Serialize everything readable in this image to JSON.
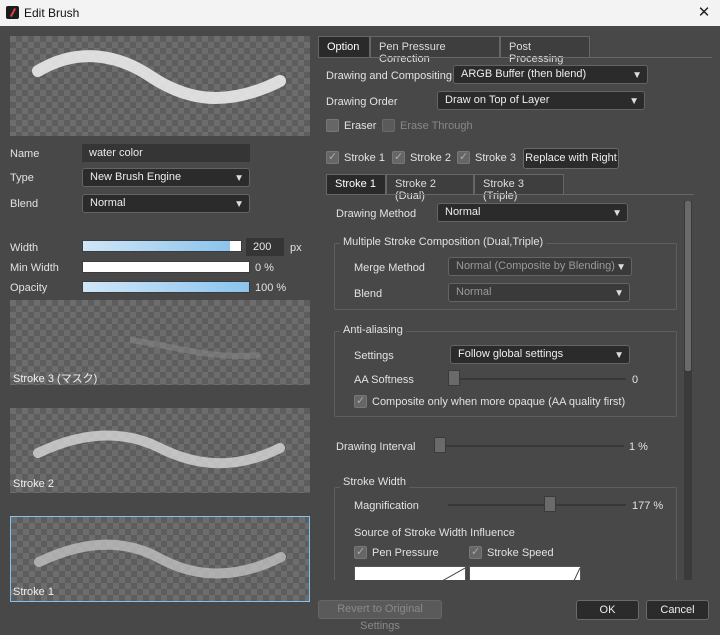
{
  "window": {
    "title": "Edit Brush",
    "close": "✕"
  },
  "left": {
    "name_label": "Name",
    "name_value": "water color",
    "type_label": "Type",
    "type_value": "New Brush Engine",
    "blend_label": "Blend",
    "blend_value": "Normal",
    "width_label": "Width",
    "width_value": "200",
    "width_unit": "px",
    "width_fill": 0.93,
    "minwidth_label": "Min Width",
    "minwidth_value": "0 %",
    "minwidth_fill": 0,
    "opacity_label": "Opacity",
    "opacity_value": "100 %",
    "opacity_fill": 1.0,
    "strokes": [
      {
        "label": "Stroke 3 (マスク)"
      },
      {
        "label": "Stroke 2"
      },
      {
        "label": "Stroke 1"
      }
    ]
  },
  "tabs": [
    "Option",
    "Pen Pressure Correction",
    "Post Processing"
  ],
  "option": {
    "compositing_label": "Drawing and Compositing",
    "compositing_value": "ARGB Buffer (then blend)",
    "order_label": "Drawing Order",
    "order_value": "Draw on Top of Layer",
    "eraser_label": "Eraser",
    "erase_through_label": "Erase Through",
    "stroke1_check": "Stroke 1",
    "stroke2_check": "Stroke 2",
    "stroke3_check": "Stroke 3",
    "replace_button": "Replace with Right",
    "stroke_tabs": [
      "Stroke 1",
      "Stroke 2 (Dual)",
      "Stroke 3 (Triple)"
    ],
    "method_label": "Drawing Method",
    "method_value": "Normal",
    "multi_group": "Multiple Stroke Composition (Dual,Triple)",
    "merge_label": "Merge Method",
    "merge_value": "Normal (Composite by Blending)",
    "mblend_label": "Blend",
    "mblend_value": "Normal",
    "aa_group": "Anti-aliasing",
    "settings_label": "Settings",
    "settings_value": "Follow global settings",
    "aasoft_label": "AA Softness",
    "aasoft_value": "0",
    "composite_label": "Composite only when more opaque (AA quality first)",
    "interval_label": "Drawing Interval",
    "interval_value": "1 %",
    "sw_group": "Stroke Width",
    "mag_label": "Magnification",
    "mag_value": "177 %",
    "source_label": "Source of Stroke Width Influence",
    "pen_pressure_label": "Pen Pressure",
    "stroke_speed_label": "Stroke Speed"
  },
  "footer": {
    "revert": "Revert to Original Settings",
    "ok": "OK",
    "cancel": "Cancel"
  }
}
